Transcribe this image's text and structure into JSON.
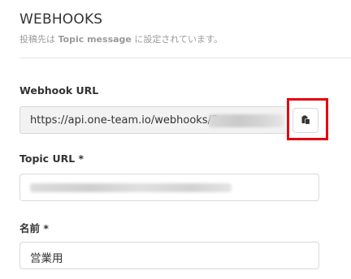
{
  "section": {
    "title": "WEBHOOKS",
    "desc_prefix": "投稿先は",
    "desc_emphasis": "Topic message",
    "desc_suffix": "に設定されています。"
  },
  "webhook": {
    "label": "Webhook URL",
    "value_visible": "https://api.one-team.io/webhooks/S",
    "copy_icon": "clipboard-copy-icon"
  },
  "topic": {
    "label": "Topic URL *"
  },
  "name": {
    "label": "名前 *",
    "value": "営業用"
  },
  "colors": {
    "highlight": "#e5000f",
    "readonly_bg": "#f2f2f2",
    "border": "#d9d9d9"
  }
}
